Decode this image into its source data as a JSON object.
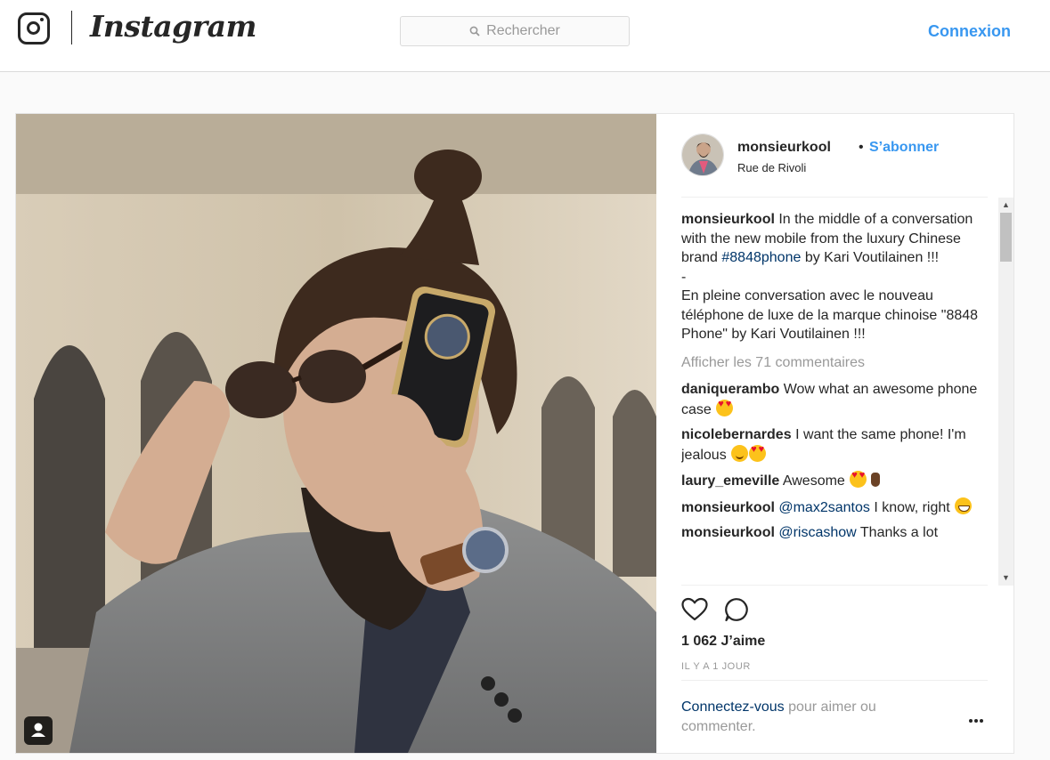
{
  "header": {
    "brand": "Instagram",
    "search_placeholder": "Rechercher",
    "login_label": "Connexion"
  },
  "post": {
    "author": {
      "username": "monsieurkool",
      "separator": "•",
      "follow_label": "S’abonner",
      "location": "Rue de Rivoli"
    },
    "caption": {
      "username": "monsieurkool",
      "text_before_tag": "In the middle of a conversation with the new mobile from the luxury Chinese brand",
      "hashtag": "#8848phone",
      "text_after_tag": "by Kari Voutilainen !!!",
      "dash": "-",
      "french": "En pleine conversation avec le nouveau téléphone de luxe de la marque chinoise \"8848 Phone\" by Kari Voutilainen !!!"
    },
    "view_all_comments": "Afficher les 71 commentaires",
    "comments": [
      {
        "username": "daniquerambo",
        "text": "Wow what an awesome phone case",
        "emojis": [
          "heart-eyes-emoji"
        ]
      },
      {
        "username": "nicolebernardes",
        "text": "I want the same phone! I'm jealous",
        "emojis": [
          "smiling-emoji",
          "heart-eyes-emoji"
        ]
      },
      {
        "username": "laury_emeville",
        "text": "Awesome",
        "emojis": [
          "heart-eyes-emoji",
          "ok-hand-emoji"
        ]
      },
      {
        "username": "monsieurkool",
        "mention": "@max2santos",
        "text": "I know, right",
        "emojis": [
          "grinning-emoji"
        ]
      },
      {
        "username": "monsieurkool",
        "mention": "@riscashow",
        "text": "Thanks a lot",
        "emojis": []
      }
    ],
    "likes": "1 062 J’aime",
    "time_ago": "IL Y A 1 JOUR",
    "login_prompt": {
      "link": "Connectez-vous",
      "rest": "pour aimer ou commenter."
    }
  },
  "icons": {
    "logo": "instagram-camera-icon",
    "search": "search-icon",
    "like": "heart-outline-icon",
    "comment": "comment-bubble-icon",
    "more": "more-options-icon",
    "tagged_user": "user-tag-icon"
  },
  "colors": {
    "link_blue": "#3897f0",
    "hashtag_navy": "#003569",
    "muted_grey": "#999999"
  }
}
